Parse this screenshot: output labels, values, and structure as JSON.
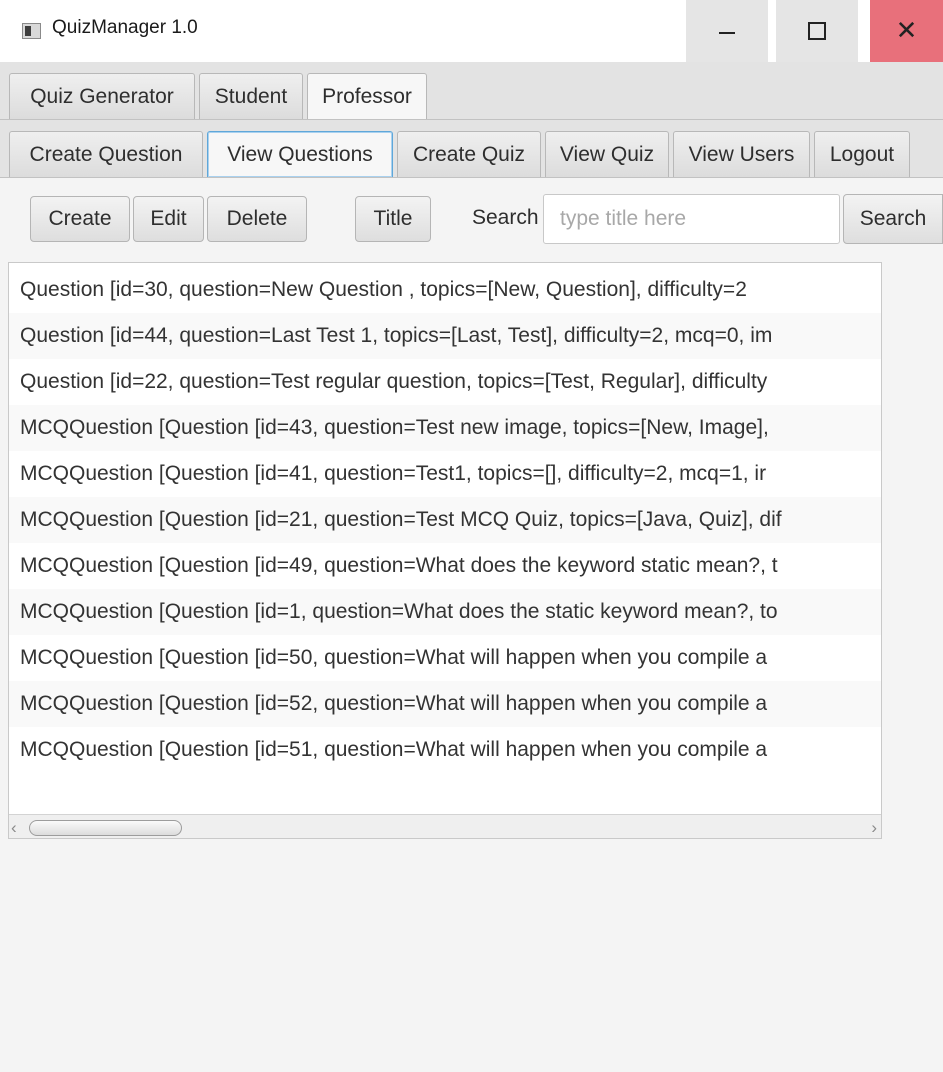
{
  "window": {
    "title": "QuizManager 1.0",
    "icons": {
      "app": "app-icon",
      "minimize": "minimize-icon",
      "maximize": "maximize-icon",
      "close": "close-icon"
    },
    "colors": {
      "close_hover": "#e8707b",
      "focus": "#5fa7d9"
    }
  },
  "main_tabs": [
    "Quiz Generator",
    "Student",
    "Professor"
  ],
  "sub_tabs": [
    "Create Question",
    "View Questions",
    "Create Quiz",
    "View Quiz",
    "View Users",
    "Logout"
  ],
  "toolbar": {
    "create": "Create",
    "edit": "Edit",
    "delete": "Delete",
    "title": "Title",
    "search_label": "Search",
    "search_placeholder": "type title here",
    "search_button": "Search"
  },
  "questions": [
    "Question [id=30, question=New Question     , topics=[New, Question], difficulty=2",
    "Question [id=44, question=Last Test 1, topics=[Last, Test], difficulty=2, mcq=0, im",
    "Question [id=22, question=Test regular question, topics=[Test, Regular], difficulty",
    "MCQQuestion [Question [id=43, question=Test new image, topics=[New, Image],",
    "MCQQuestion [Question [id=41, question=Test1, topics=[], difficulty=2, mcq=1, ir",
    "MCQQuestion [Question [id=21, question=Test MCQ Quiz, topics=[Java, Quiz], dif",
    "MCQQuestion [Question [id=49, question=What does the keyword static mean?, t",
    "MCQQuestion [Question [id=1, question=What does the static keyword mean?, to",
    "MCQQuestion [Question [id=50, question=What will happen when you compile a",
    "MCQQuestion [Question [id=52, question=What will happen when you compile a",
    "MCQQuestion [Question [id=51, question=What will happen when you compile a"
  ],
  "scroll": {
    "left_arrow": "‹",
    "right_arrow": "›"
  }
}
